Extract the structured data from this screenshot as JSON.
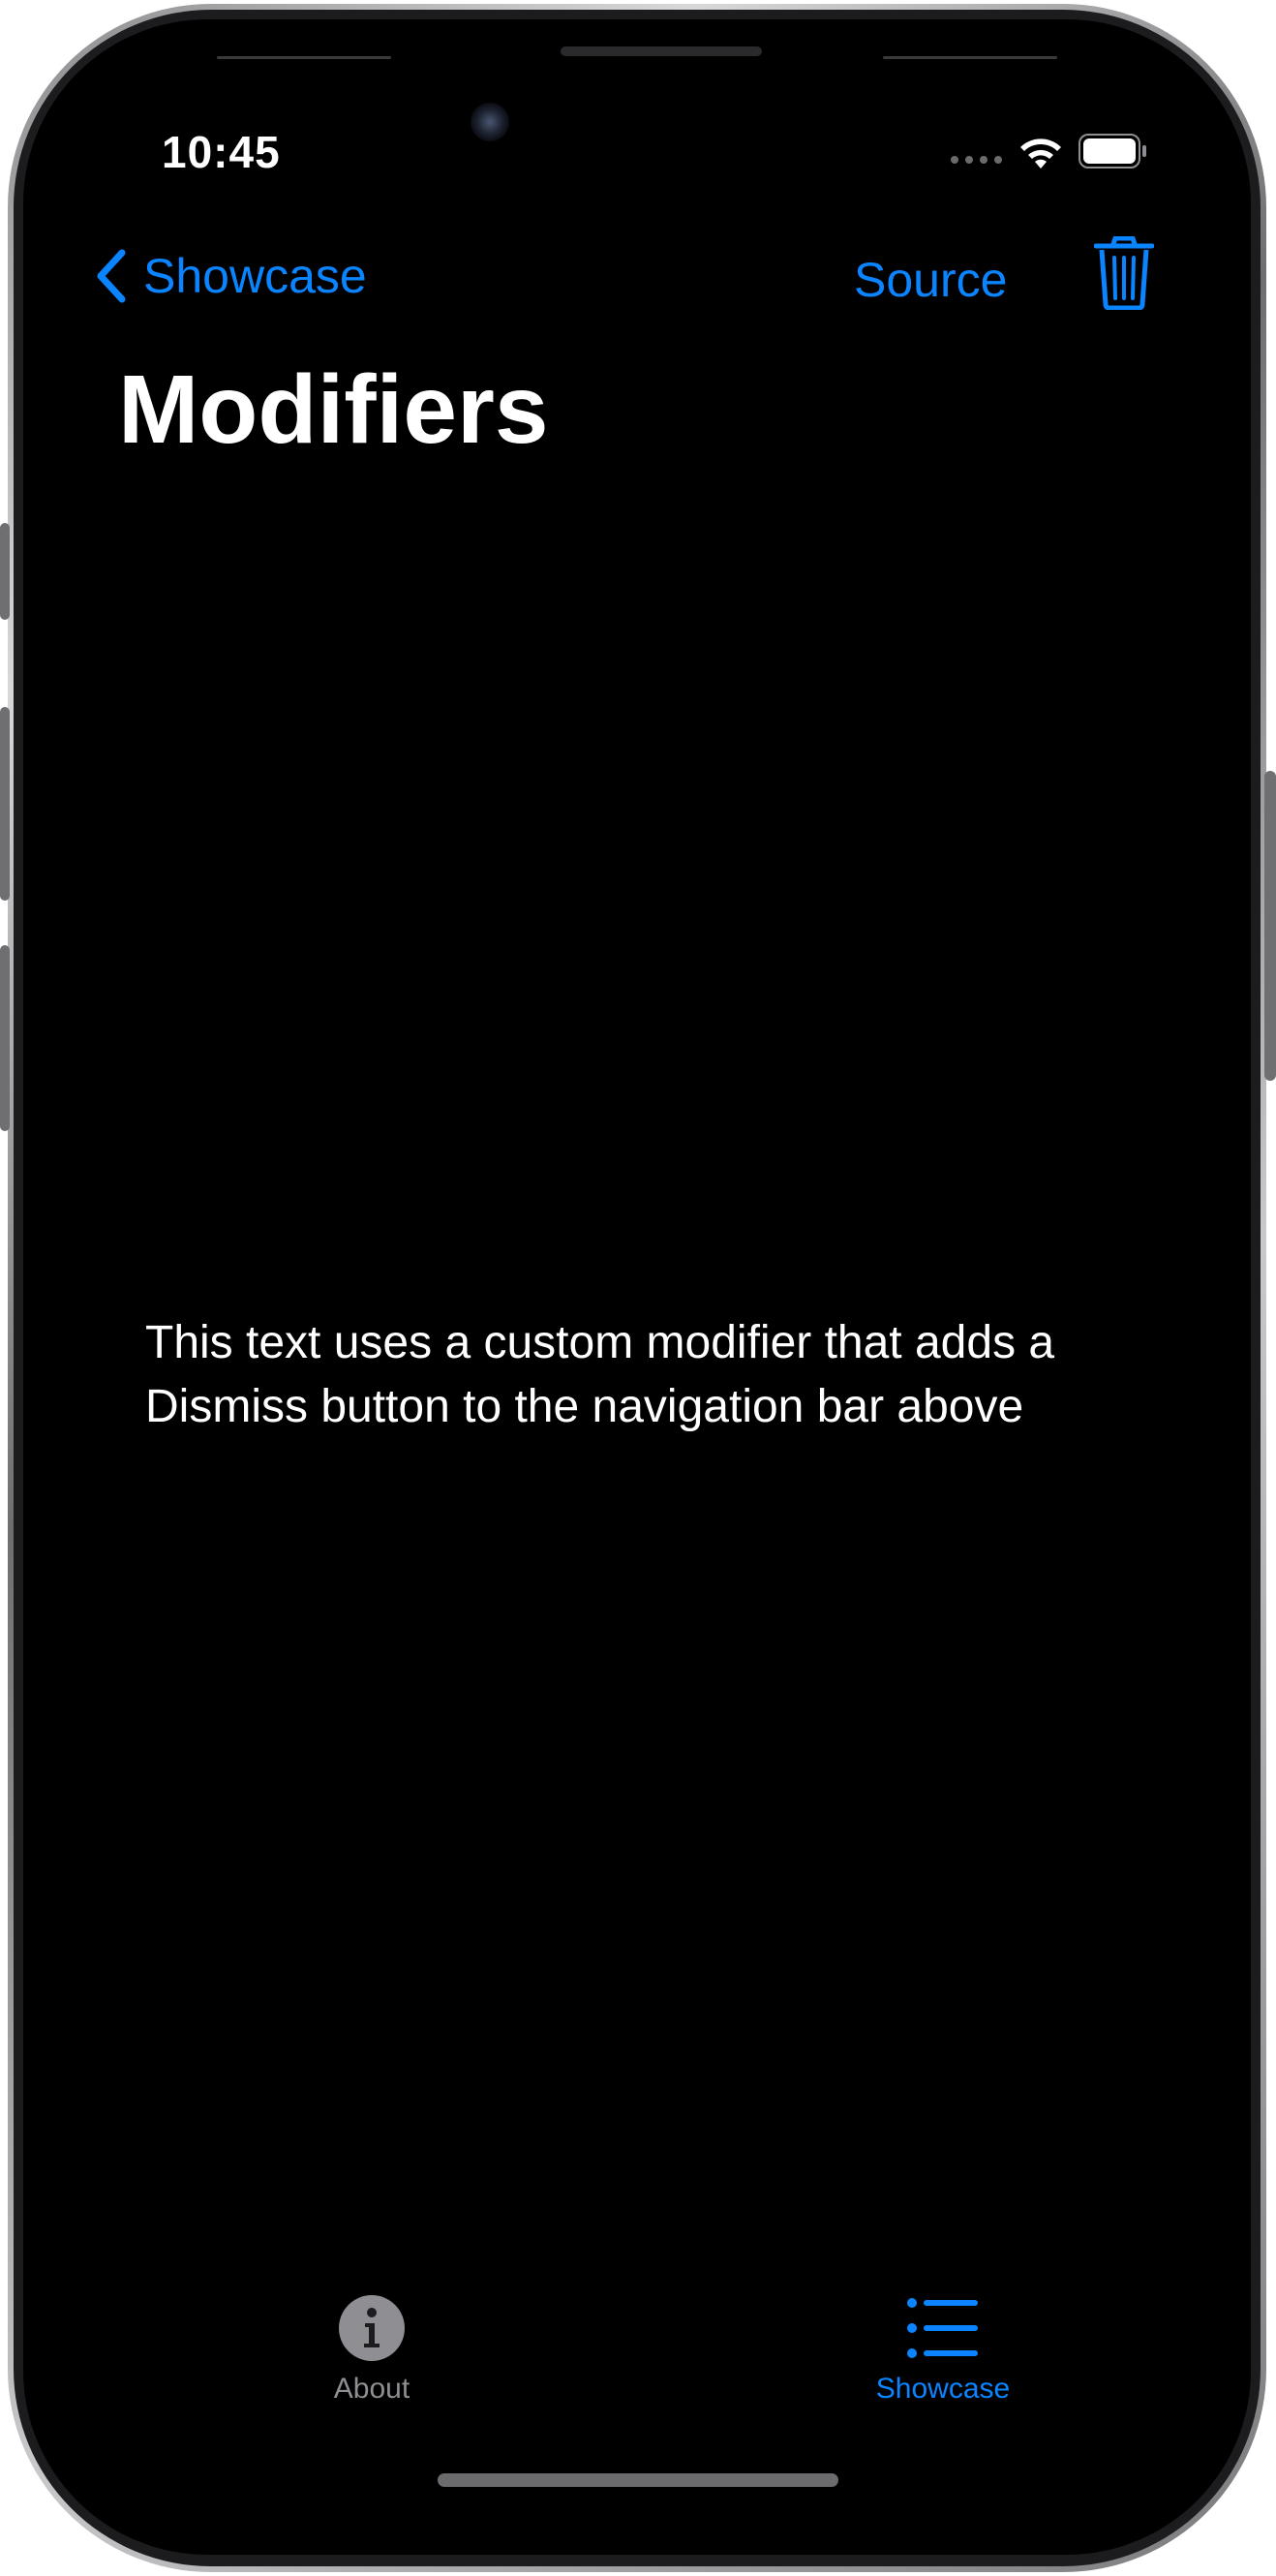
{
  "status_bar": {
    "time": "10:45"
  },
  "nav_bar": {
    "back_label": "Showcase",
    "source_label": "Source"
  },
  "page": {
    "title": "Modifiers",
    "body_text": "This text uses a custom modifier that adds a Dismiss button to the navigation bar above"
  },
  "tab_bar": {
    "items": [
      {
        "label": "About",
        "icon": "info-circle-icon",
        "selected": false
      },
      {
        "label": "Showcase",
        "icon": "list-bullet-icon",
        "selected": true
      }
    ]
  },
  "colors": {
    "accent": "#0a84ff",
    "background": "#000000",
    "text": "#ffffff",
    "inactive": "#8e8e93"
  }
}
